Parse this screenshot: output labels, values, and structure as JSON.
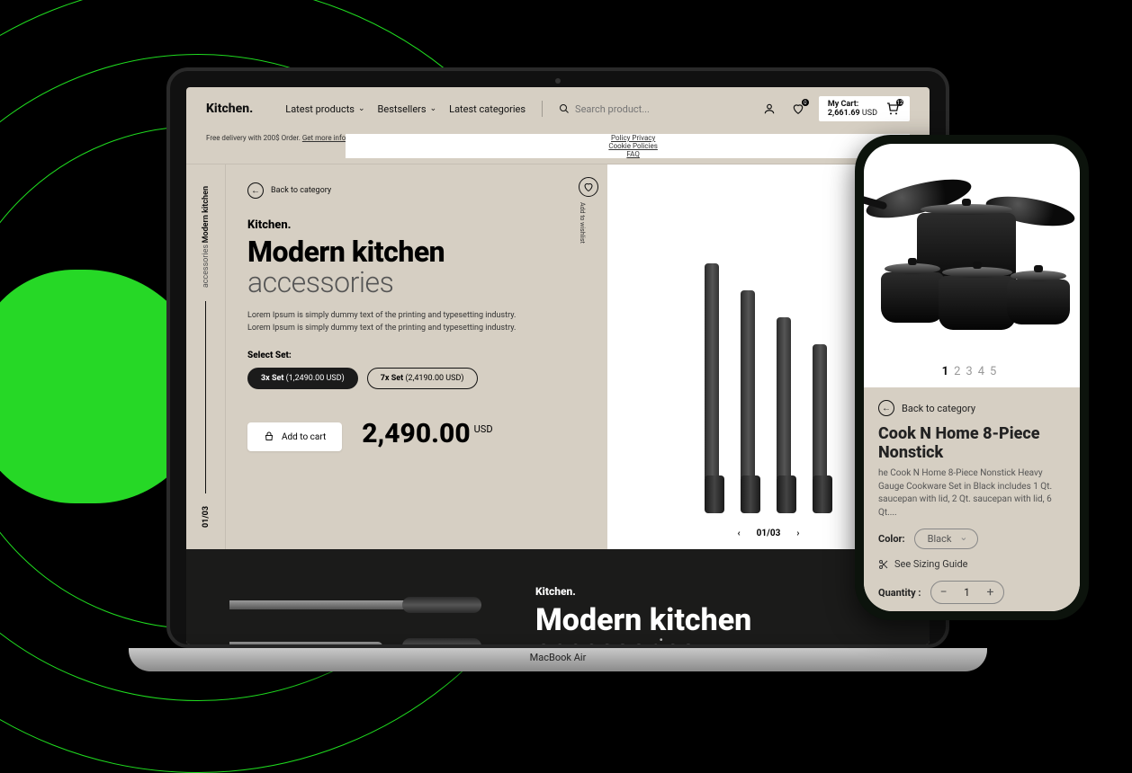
{
  "desktop": {
    "logo": "Kitchen.",
    "nav": {
      "latest_products": "Latest products",
      "bestsellers": "Bestsellers",
      "latest_categories": "Latest categories"
    },
    "search_placeholder": "Search product...",
    "wishlist_badge": "0",
    "cart": {
      "label": "My Cart:",
      "amount": "2,661.69",
      "currency": "USD",
      "count": "12"
    },
    "notice": {
      "text": "Free delivery with 200$ Order.",
      "more": "Get more info"
    },
    "footer_links": {
      "privacy": "Policy Privacy",
      "cookies": "Cookie Policies",
      "faq": "FAQ"
    },
    "rail": {
      "line1": "Modern kitchen",
      "line2": "accessories",
      "page": "01/03"
    },
    "back_label": "Back to category",
    "wishlist_label": "Add to wishlist",
    "brand": "Kitchen.",
    "title_a": "Modern kitchen",
    "title_b": "accessories",
    "desc": "Lorem Ipsum is simply dummy text of the printing and typesetting industry. Lorem Ipsum is simply dummy text of the printing and typesetting industry.",
    "select_label": "Select Set:",
    "sets": [
      {
        "name": "3x Set",
        "price": "(1,2490.00 USD)"
      },
      {
        "name": "7x Set",
        "price": "(2,4190.00 USD)"
      }
    ],
    "add_to_cart": "Add to cart",
    "price": "2,490.00",
    "price_currency": "USD",
    "pager": "01/03",
    "band": {
      "brand": "Kitchen.",
      "title_a": "Modern kitchen",
      "title_b": "accessories"
    }
  },
  "mobile": {
    "dots": [
      "1",
      "2",
      "3",
      "4",
      "5"
    ],
    "back_label": "Back to category",
    "title": "Cook N Home 8-Piece Nonstick",
    "desc": "he Cook N Home 8-Piece Nonstick Heavy Gauge Cookware Set in Black includes 1 Qt. saucepan with lid, 2 Qt. saucepan with lid, 6 Qt....",
    "color_label": "Color:",
    "color_value": "Black",
    "sizing": "See Sizing Guide",
    "qty_label": "Quantity :",
    "qty_value": "1"
  },
  "laptop_brand": "MacBook Air"
}
